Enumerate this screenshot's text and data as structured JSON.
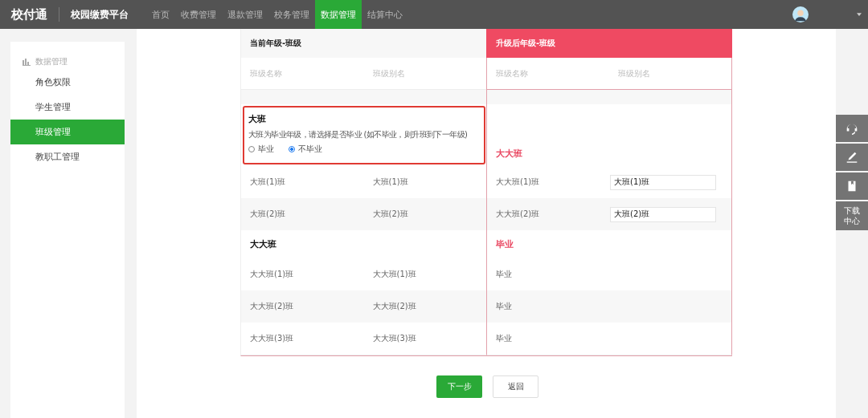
{
  "topbar": {
    "logo": "校付通",
    "platform": "校园缴费平台",
    "nav": [
      {
        "label": "首页",
        "selected": false
      },
      {
        "label": "收费管理",
        "selected": false
      },
      {
        "label": "退款管理",
        "selected": false
      },
      {
        "label": "校务管理",
        "selected": false
      },
      {
        "label": "数据管理",
        "selected": true
      },
      {
        "label": "结算中心",
        "selected": false
      }
    ]
  },
  "sidebar": {
    "title": "数据管理",
    "items": [
      {
        "label": "角色权限",
        "selected": false
      },
      {
        "label": "学生管理",
        "selected": false
      },
      {
        "label": "班级管理",
        "selected": true
      },
      {
        "label": "教职工管理",
        "selected": false
      }
    ]
  },
  "table": {
    "current_header": "当前年级-班级",
    "target_header": "升级后年级-班级",
    "columns": [
      "班级名称",
      "班级别名",
      "班级名称",
      "班级别名"
    ],
    "groups": [
      {
        "name": "大班",
        "note": "大班为毕业年级，请选择是否毕业 (如不毕业，则升班到下一年级)",
        "options": [
          {
            "label": "毕业",
            "selected": false
          },
          {
            "label": "不毕业",
            "selected": true
          }
        ],
        "target": "大大班",
        "rows": [
          {
            "name": "大班(1)班",
            "alias": "大班(1)班",
            "target": "大大班(1)班",
            "target_alias": "大班(1)班"
          },
          {
            "name": "大班(2)班",
            "alias": "大班(2)班",
            "target": "大大班(2)班",
            "target_alias": "大班(2)班"
          }
        ]
      },
      {
        "name": "大大班",
        "target": "毕业",
        "rows": [
          {
            "name": "大大班(1)班",
            "alias": "大大班(1)班",
            "target": "毕业"
          },
          {
            "name": "大大班(2)班",
            "alias": "大大班(2)班",
            "target": "毕业"
          },
          {
            "name": "大大班(3)班",
            "alias": "大大班(3)班",
            "target": "毕业"
          }
        ]
      }
    ]
  },
  "buttons": {
    "next": "下一步",
    "back": "返回"
  },
  "tools": {
    "download": "下载中心"
  }
}
